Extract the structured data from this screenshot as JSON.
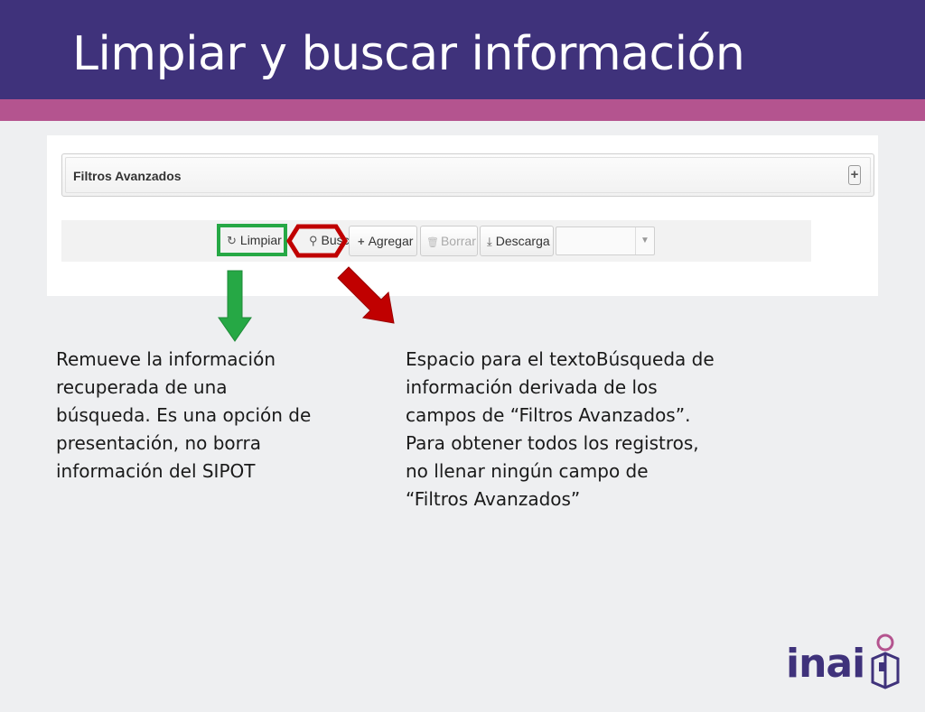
{
  "slide": {
    "title": "Limpiar y buscar información"
  },
  "colors": {
    "header": "#3f327b",
    "stripe": "#b4548f",
    "highlight_green": "#26a845",
    "highlight_red": "#c00000"
  },
  "filters": {
    "label": "Filtros Avanzados",
    "expand_icon": "plus-icon",
    "expand_symbol": "+"
  },
  "toolbar": {
    "buttons": [
      {
        "label": "Limpiar",
        "icon": "refresh-icon",
        "symbol": "↻",
        "enabled": true
      },
      {
        "label": "Buscar",
        "icon": "search-icon",
        "symbol": "⚲",
        "enabled": true
      },
      {
        "label": "Agregar",
        "icon": "plus-icon",
        "symbol": "+",
        "enabled": true
      },
      {
        "label": "Borrar",
        "icon": "trash-icon",
        "symbol": "🗑",
        "enabled": false
      },
      {
        "label": "Descarga",
        "icon": "download-icon",
        "symbol": "⤓",
        "enabled": true
      }
    ],
    "select_value": ""
  },
  "descriptions": {
    "limpiar": [
      "Remueve la información",
      "recuperada de una",
      "búsqueda. Es una opción de",
      "presentación, no borra",
      "información del SIPOT"
    ],
    "buscar": [
      "Espacio para el textoBúsqueda de",
      "información derivada de los",
      "campos de “Filtros Avanzados”.",
      "Para obtener todos los registros,",
      "no llenar ningún campo de",
      "“Filtros Avanzados”"
    ]
  },
  "logo": {
    "text": "inai",
    "icon": "inai-person-book-icon"
  }
}
